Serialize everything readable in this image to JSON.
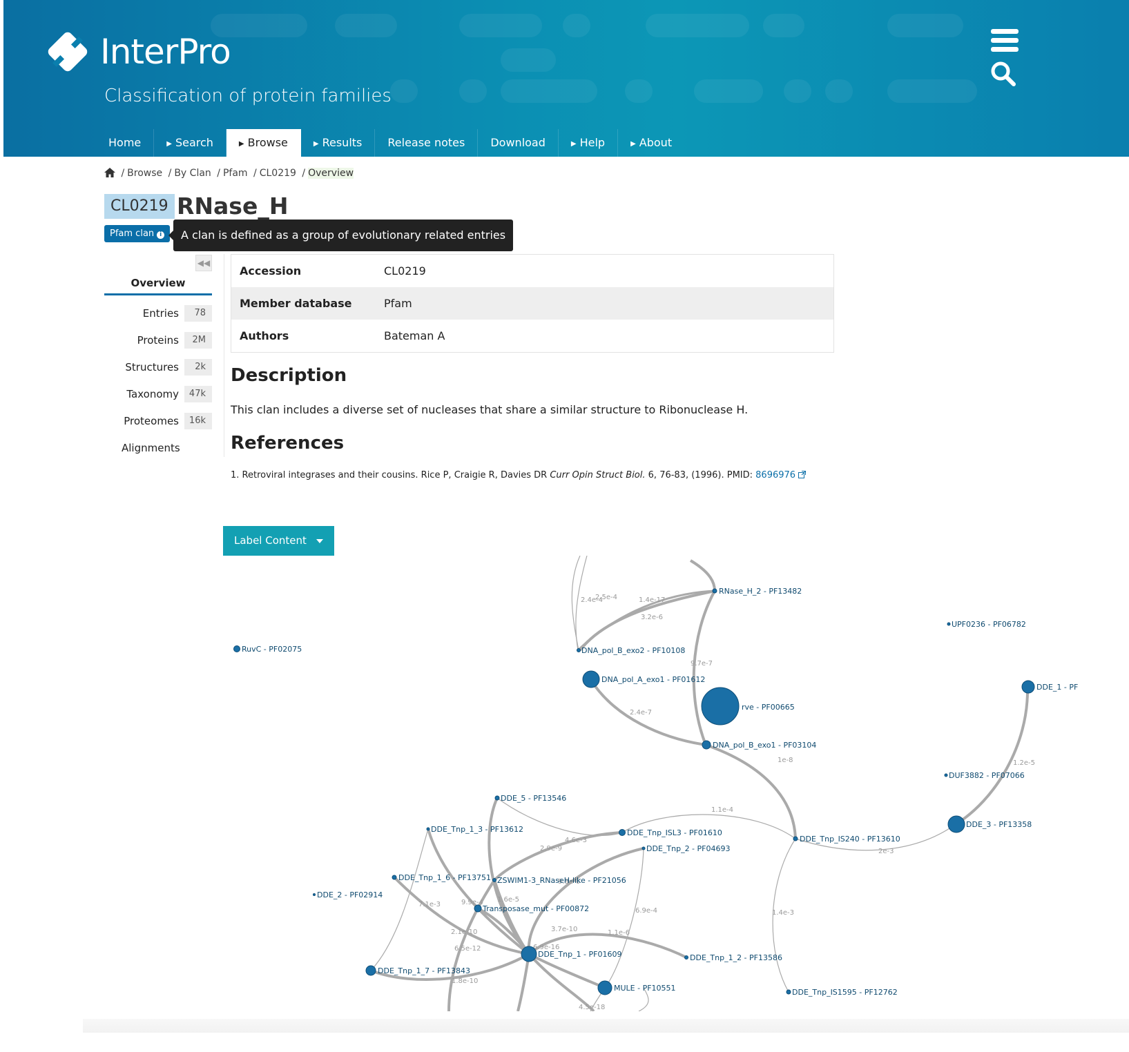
{
  "header": {
    "logo_text": "InterPro",
    "subtitle": "Classification of protein families",
    "icons": [
      "hamburger-menu-icon",
      "search-icon"
    ]
  },
  "nav": {
    "items": [
      {
        "label": "Home",
        "arrow": false
      },
      {
        "label": "Search",
        "arrow": true
      },
      {
        "label": "Browse",
        "arrow": true,
        "active": true
      },
      {
        "label": "Results",
        "arrow": true
      },
      {
        "label": "Release notes",
        "arrow": false
      },
      {
        "label": "Download",
        "arrow": false
      },
      {
        "label": "Help",
        "arrow": true
      },
      {
        "label": "About",
        "arrow": true
      }
    ]
  },
  "breadcrumb": [
    "Browse",
    "By Clan",
    "Pfam",
    "CL0219",
    "Overview"
  ],
  "entry": {
    "accession": "CL0219",
    "name": "RNase_H",
    "badge": "Pfam clan",
    "tooltip": "A clan is defined as a group of evolutionary related entries"
  },
  "sidebar": {
    "overview": "Overview",
    "items": [
      {
        "label": "Entries",
        "count": "78"
      },
      {
        "label": "Proteins",
        "count": "2M"
      },
      {
        "label": "Structures",
        "count": "2k"
      },
      {
        "label": "Taxonomy",
        "count": "47k"
      },
      {
        "label": "Proteomes",
        "count": "16k"
      },
      {
        "label": "Alignments",
        "count": ""
      }
    ]
  },
  "info_table": [
    {
      "key": "Accession",
      "value": "CL0219"
    },
    {
      "key": "Member database",
      "value": "Pfam"
    },
    {
      "key": "Authors",
      "value": "Bateman A"
    }
  ],
  "description": {
    "heading": "Description",
    "text": "This clan includes a diverse set of nucleases that share a similar structure to Ribonuclease H."
  },
  "references": {
    "heading": "References",
    "item": {
      "num": "1.",
      "text": "Retroviral integrases and their cousins. Rice P, Craigie R, Davies DR",
      "journal": "Curr Opin Struct Biol.",
      "details": "6, 76-83, (1996). PMID:",
      "pmid": "8696976"
    }
  },
  "label_button": "Label Content",
  "graph": {
    "node_color": "#1a6fa6",
    "edge_color": "#aaaaaa",
    "nodes": [
      {
        "label": "RNase_H_2 - PF13482"
      },
      {
        "label": "UPF0236 - PF06782"
      },
      {
        "label": "RuvC - PF02075"
      },
      {
        "label": "DNA_pol_B_exo2 - PF10108"
      },
      {
        "label": "DNA_pol_A_exo1 - PF01612"
      },
      {
        "label": "rve - PF00665"
      },
      {
        "label": "DDE_1 - PF"
      },
      {
        "label": "DNA_pol_B_exo1 - PF03104"
      },
      {
        "label": "DUF3882 - PF07066"
      },
      {
        "label": "DDE_5 - PF13546"
      },
      {
        "label": "DDE_3 - PF13358"
      },
      {
        "label": "DDE_Tnp_1_3 - PF13612"
      },
      {
        "label": "DDE_Tnp_ISL3 - PF01610"
      },
      {
        "label": "DDE_Tnp_IS240 - PF13610"
      },
      {
        "label": "DDE_Tnp_2 - PF04693"
      },
      {
        "label": "DDE_Tnp_1_6 - PF13751"
      },
      {
        "label": "ZSWIM1-3_RNaseH-like - PF21056"
      },
      {
        "label": "DDE_2 - PF02914"
      },
      {
        "label": "Transposase_mut - PF00872"
      },
      {
        "label": "DDE_Tnp_1 - PF01609"
      },
      {
        "label": "DDE_Tnp_1_2 - PF13586"
      },
      {
        "label": "DDE_Tnp_1_7 - PF13843"
      },
      {
        "label": "MULE - PF10551"
      },
      {
        "label": "DDE_Tnp_IS1595 - PF12762"
      }
    ],
    "edge_labels": [
      "2.4e-4",
      "2.5e-4",
      "1.4e-17",
      "3.2e-6",
      "9.7e-7",
      "2.4e-7",
      "1e-8",
      "1.2e-5",
      "1.1e-4",
      "2e-3",
      "4.6e-3",
      "2.9e-9",
      "1.4e-3",
      "7.1e-3",
      "9.9e-4",
      "6.9e-4",
      "2.1e-10",
      "6.5e-12",
      "3.7e-10",
      "1.1e-6",
      "6.9e-16",
      "1.8e-10",
      "4.5e-18",
      "9.9e-6",
      "1.6e-5"
    ]
  }
}
